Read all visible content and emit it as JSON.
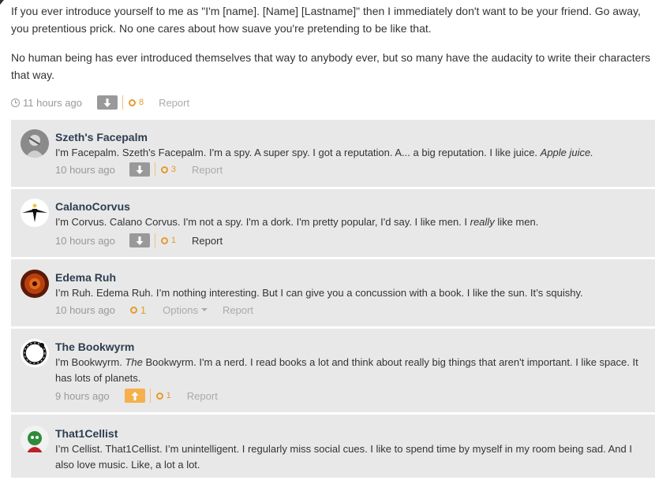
{
  "post": {
    "paragraphs": [
      "If you ever introduce yourself to me as \"I'm [name]. [Name] [Lastname]\" then I immediately don't want to be your friend. Go away, you pretentious prick. No one cares about how suave you're pretending to be like that.",
      "No human being has ever introduced themselves that way to anybody ever, but so many have the audacity to write their characters that way."
    ],
    "time": "11 hours ago",
    "score": "8",
    "report_label": "Report"
  },
  "comments": [
    {
      "author": "Szeth's Facepalm",
      "text_pre": "I'm Facepalm. Szeth's Facepalm. I'm a spy. A super spy. I got a reputation. A... a big reputation. I like juice. ",
      "text_em": "Apple juice.",
      "text_post": "",
      "time": "10 hours ago",
      "score": "3",
      "report_label": "Report"
    },
    {
      "author": "CalanoCorvus",
      "text_pre": "I'm Corvus. Calano Corvus. I'm not a spy. I'm a dork. I'm pretty popular, I'd say. I like men. I ",
      "text_em": "really",
      "text_post": " like men.",
      "time": "10 hours ago",
      "score": "1",
      "report_label": "Report"
    },
    {
      "author": "Edema Ruh",
      "text_pre": "I’m Ruh. Edema Ruh. I’m nothing interesting. But I can give you a concussion with a book. I like the sun. It’s squishy.",
      "text_em": "",
      "text_post": "",
      "time": "10 hours ago",
      "score": "1",
      "options_label": "Options",
      "report_label": "Report"
    },
    {
      "author": "The Bookwyrm",
      "text_pre": "I'm Bookwyrm. ",
      "text_em": "The",
      "text_post": " Bookwyrm. I'm a nerd. I read books a lot and think about really big things that aren't important. I like space. It has lots of planets.",
      "time": "9 hours ago",
      "score": "1",
      "report_label": "Report"
    },
    {
      "author": "That1Cellist",
      "text_pre": "I’m Cellist. That1Cellist. I’m unintelligent. I regularly miss social cues. I like to spend time by myself in my room being sad. And I also love music. Like, a lot a lot.",
      "text_em": "",
      "text_post": "",
      "time": "",
      "score": "",
      "report_label": ""
    }
  ],
  "colors": {
    "author": "#2c3e50",
    "accent": "#e69a2e",
    "comment_bg": "#e8e8e8",
    "muted": "#999999"
  },
  "icons": [
    "clock-icon",
    "downvote-arrow-icon",
    "upvote-arrow-icon",
    "score-dot-icon",
    "caret-down-icon"
  ]
}
